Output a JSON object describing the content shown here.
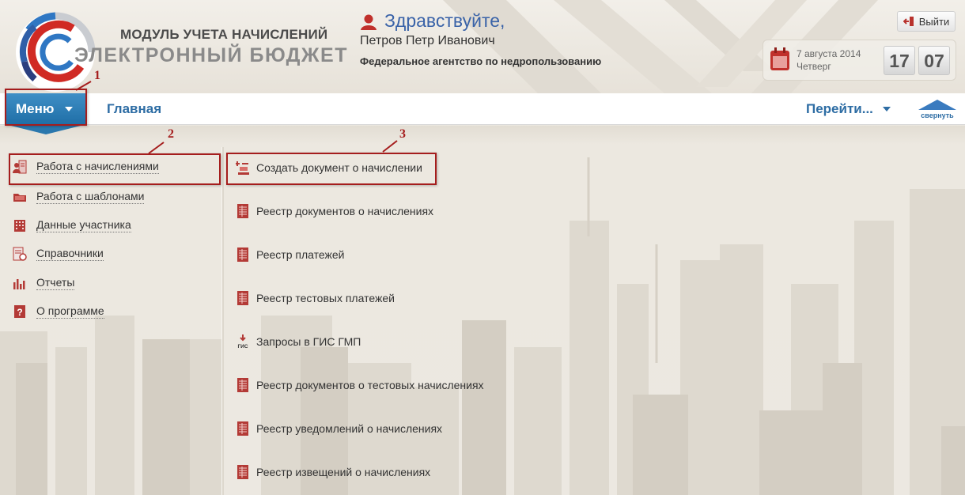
{
  "header": {
    "brand_line1": "МОДУЛЬ УЧЕТА НАЧИСЛЕНИЙ",
    "brand_line2": "ЭЛЕКТРОННЫЙ БЮДЖЕТ",
    "greeting": "Здравствуйте,",
    "user_name": "Петров Петр Иванович",
    "organization": "Федеральное агентство по недропользованию",
    "logout_label": "Выйти",
    "date": "7 августа 2014",
    "weekday": "Четверг",
    "time_hours": "17",
    "time_minutes": "07"
  },
  "nav": {
    "menu_label": "Меню",
    "home_label": "Главная",
    "goto_label": "Перейти...",
    "collapse_label": "свернуть"
  },
  "sidebar": {
    "items": [
      {
        "label": "Работа с начислениями",
        "icon": "person-document-icon"
      },
      {
        "label": "Работа с шаблонами",
        "icon": "folder-icon"
      },
      {
        "label": "Данные участника",
        "icon": "building-icon"
      },
      {
        "label": "Справочники",
        "icon": "reference-book-icon"
      },
      {
        "label": "Отчеты",
        "icon": "bar-chart-icon"
      },
      {
        "label": "О программе",
        "icon": "question-icon"
      }
    ]
  },
  "main": {
    "items": [
      {
        "label": "Создать документ о начислении",
        "icon": "create-document-icon"
      },
      {
        "label": "Реестр документов о начислениях",
        "icon": "register-icon"
      },
      {
        "label": "Реестр платежей",
        "icon": "register-icon"
      },
      {
        "label": "Реестр тестовых платежей",
        "icon": "register-icon"
      },
      {
        "label": "Запросы в ГИС ГМП",
        "icon": "gis-download-icon",
        "icon_text": "ГИС"
      },
      {
        "label": "Реестр документов о тестовых начислениях",
        "icon": "register-icon"
      },
      {
        "label": "Реестр уведомлений о начислениях",
        "icon": "register-icon"
      },
      {
        "label": "Реестр извещений о начислениях",
        "icon": "register-icon"
      }
    ]
  },
  "annotations": [
    "1",
    "2",
    "3"
  ],
  "colors": {
    "accent_blue": "#2e6da4",
    "menu_blue": "#2a77ad",
    "annotation_red": "#a51d1d",
    "icon_red": "#b33a36"
  }
}
